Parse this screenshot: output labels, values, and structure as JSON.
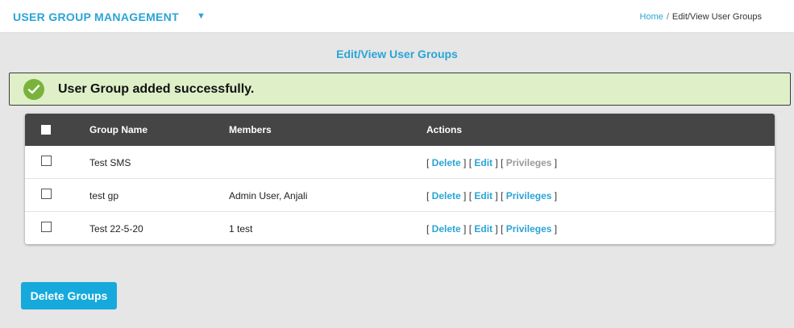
{
  "header": {
    "module_title": "USER GROUP MANAGEMENT",
    "caret_icon": "caret-down-icon",
    "breadcrumb": {
      "home": "Home",
      "separator": "/",
      "current": "Edit/View User Groups"
    }
  },
  "page": {
    "title": "Edit/View User Groups"
  },
  "alert": {
    "icon": "check-circle-icon",
    "message": "User Group added successfully.",
    "bg_color": "#dff0c8",
    "icon_color": "#7ab33b"
  },
  "table": {
    "columns": {
      "group_name": "Group Name",
      "members": "Members",
      "actions": "Actions"
    },
    "action_labels": {
      "delete": "Delete",
      "edit": "Edit",
      "privileges": "Privileges"
    },
    "rows": [
      {
        "group_name": "Test SMS",
        "members": "",
        "privileges_enabled": false
      },
      {
        "group_name": "test gp",
        "members": "Admin User, Anjali",
        "privileges_enabled": true
      },
      {
        "group_name": "Test 22-5-20",
        "members": "1 test",
        "privileges_enabled": true
      }
    ]
  },
  "footer": {
    "delete_button": "Delete Groups"
  },
  "colors": {
    "accent": "#2aa4d5",
    "button": "#16a9dc",
    "table_header": "#454545"
  }
}
